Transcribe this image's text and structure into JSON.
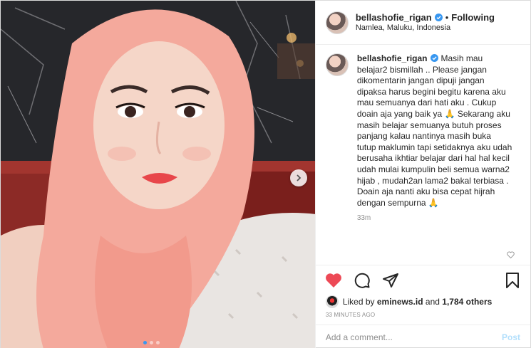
{
  "post": {
    "username": "bellashofie_rigan",
    "follow_separator": "•",
    "follow_status": "Following",
    "location": "Namlea, Maluku, Indonesia"
  },
  "caption": {
    "username": "bellashofie_rigan",
    "text": "Masih mau belajar2 bismillah .. Please jangan dikomentarin jangan dipuji jangan dipaksa harus begini begitu karena aku mau semuanya dari hati aku . Cukup doain aja yang baik ya 🙏 Sekarang aku masih belajar semuanya butuh proses panjang kalau nantinya masih buka tutup maklumin tapi setidaknya aku udah berusaha ikhtiar belajar dari hal hal kecil udah mulai kumpulin beli semua warna2 hijab , mudah2an lama2 bakal terbiasa . Doain aja nanti aku bisa cepat hijrah dengan sempurna 🙏",
    "time": "33m"
  },
  "likes": {
    "prefix": "Liked by",
    "user": "eminews.id",
    "joiner": "and",
    "others": "1,784 others"
  },
  "timestamp": "33 MINUTES AGO",
  "comment_box": {
    "placeholder": "Add a comment...",
    "post_label": "Post"
  },
  "carousel": {
    "count": 3,
    "active_index": 0
  },
  "colors": {
    "accent": "#3897f0",
    "like_red": "#ed4956",
    "verified_blue": "#3897f0",
    "post_disabled": "#b2dffc"
  },
  "icons": {
    "like": "heart-filled-icon",
    "comment": "speech-bubble-icon",
    "share": "paper-plane-icon",
    "save": "bookmark-icon",
    "verified": "verified-badge-icon",
    "next": "chevron-right-icon"
  }
}
